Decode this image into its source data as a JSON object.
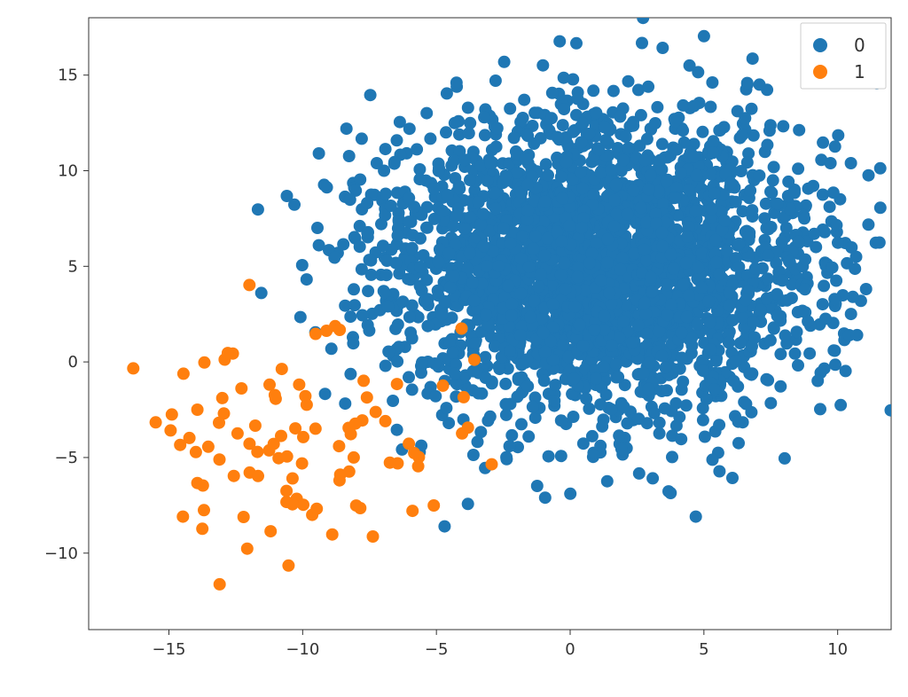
{
  "chart_data": {
    "type": "scatter",
    "xlim": [
      -18,
      12
    ],
    "ylim": [
      -14,
      18
    ],
    "xticks": [
      -15,
      -10,
      -5,
      0,
      5,
      10
    ],
    "yticks": [
      -10,
      -5,
      0,
      5,
      10,
      15
    ],
    "xlabel": "",
    "ylabel": "",
    "title": "",
    "legend_position": "upper-right",
    "grid": false,
    "series": [
      {
        "name": "0",
        "color": "#1f77b4",
        "cluster": {
          "cx": 1.0,
          "cy": 5.0,
          "sx": 4.0,
          "sy": 4.0,
          "n": 3000
        },
        "extent": {
          "xmin": -12,
          "xmax": 11,
          "ymin": -7,
          "ymax": 16.5
        }
      },
      {
        "name": "1",
        "color": "#ff7f0e",
        "cluster": {
          "cx": -10.0,
          "cy": -4.0,
          "sx": 3.0,
          "sy": 3.0,
          "n": 100
        },
        "extent": {
          "xmin": -17,
          "xmax": -3,
          "ymin": -12,
          "ymax": 4
        }
      }
    ],
    "legend": {
      "entries": [
        {
          "label": "0",
          "color": "#1f77b4"
        },
        {
          "label": "1",
          "color": "#ff7f0e"
        }
      ]
    },
    "marker": {
      "radius_px": 7,
      "alpha": 1.0
    }
  },
  "ui": {
    "xtick_labels": {
      "-15": "−15",
      "-10": "−10",
      "-5": "−5",
      "0": "0",
      "5": "5",
      "10": "10"
    },
    "ytick_labels": {
      "-10": "−10",
      "-5": "−5",
      "0": "0",
      "5": "5",
      "10": "10",
      "15": "15"
    }
  }
}
